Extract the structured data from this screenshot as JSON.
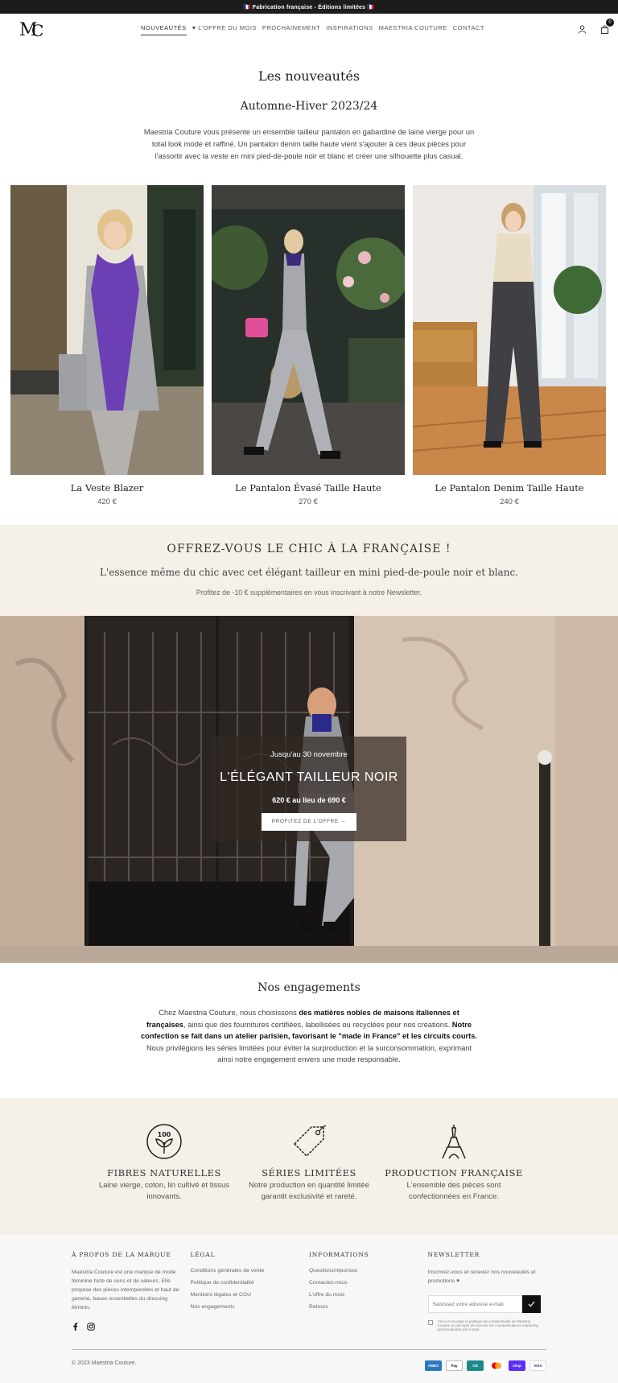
{
  "announcement": "🇫🇷 Fabrication française - Éditions limitées 🇫🇷",
  "brand": {
    "logo_text": "MC"
  },
  "nav": {
    "items": [
      {
        "label": "Nouveautés",
        "active": true
      },
      {
        "label": "♥ L'offre du mois",
        "active": false
      },
      {
        "label": "Prochainement",
        "active": false
      },
      {
        "label": "Inspirations",
        "active": false
      },
      {
        "label": "Maestria Couture",
        "active": false
      },
      {
        "label": "Contact",
        "active": false
      }
    ],
    "cart_count": "0"
  },
  "intro": {
    "title": "Les nouveautés",
    "season": "Automne-Hiver 2023/24",
    "text": "Maestria Couture vous présente un ensemble tailleur pantalon en gabardine de laine vierge pour un total look mode et raffiné. Un pantalon denim taille haute vient s'ajouter à ces deux pièces pour l'assortir avec la veste en mini pied-de-poule noir et blanc et créer une silhouette plus casual."
  },
  "products": [
    {
      "name": "La Veste Blazer",
      "price": "420 €"
    },
    {
      "name": "Le Pantalon Évasé Taille Haute",
      "price": "270 €"
    },
    {
      "name": "Le Pantalon Denim Taille Haute",
      "price": "240 €"
    }
  ],
  "offer": {
    "title": "OFFREZ-VOUS LE CHIC À LA FRANÇAISE !",
    "subtitle": "L'essence même du chic avec cet élégant tailleur en mini pied-de-poule noir et blanc.",
    "note": "Profitez de -10 € supplémentaires en vous inscrivant à notre Newsletter."
  },
  "hero": {
    "date": "Jusqu'au 30 novembre",
    "title": "L'ÉLÉGANT TAILLEUR NOIR",
    "price": "620 € au lieu de 690 €",
    "button": "PROFITEZ DE L'OFFRE →"
  },
  "engagements": {
    "title": "Nos engagements",
    "p1": "Chez Maestria Couture, nous choisissons ",
    "b1": "des matières nobles de maisons italiennes et françaises",
    "p2": ", ainsi que des fournitures certifiées, labellisées ou recyclées pour nos créations. ",
    "b2": "Notre confection se fait dans un atelier parisien, favorisant le \"made in France\" et les circuits courts.",
    "p3": " Nous privilégions les séries limitées pour éviter la surproduction et la surconsommation, exprimant ainsi notre engagement envers une mode responsable."
  },
  "features": [
    {
      "icon": "leaf-badge-icon",
      "badge": "100",
      "title": "FIBRES NATURELLES",
      "text": "Laine vierge, coton, lin cultivé et tissus innovants."
    },
    {
      "icon": "tag-icon",
      "title": "SÉRIES LIMITÉES",
      "text": "Notre production en quantité limitée garantit exclusivité et rareté."
    },
    {
      "icon": "eiffel-tower-icon",
      "title": "PRODUCTION FRANÇAISE",
      "text": "L'ensemble des pièces sont confectionnées en France."
    }
  ],
  "footer": {
    "about": {
      "heading": "À propos de la marque",
      "text": "Maestria Couture est une marque de mode féminine forte de sens et de valeurs. Elle propose des pièces intemporelles et haut de gamme, bases essentielles du dressing féminin."
    },
    "legal": {
      "heading": "Légal",
      "links": [
        "Conditions générales de vente",
        "Politique de confidentialité",
        "Mentions légales et CGU",
        "Nos engagements"
      ]
    },
    "info": {
      "heading": "Informations",
      "links": [
        "Questions/réponses",
        "Contactez-nous",
        "L'offre du mois",
        "Retours"
      ]
    },
    "newsletter": {
      "heading": "Newsletter",
      "text": "Inscrivez-vous et recevez nos nouveautés et promotions ♥",
      "placeholder": "Saisissez votre adresse e-mail",
      "consent": "J'ai lu et accepte la politique de confidentialité de Maestria Couture et j'accepte de recevoir les communications marketing personnalisées par e-mail."
    },
    "copyright": "© 2023 Maestria Couture.",
    "payments": [
      {
        "label": "AMEX",
        "color": "#2e77bc"
      },
      {
        "label": "Pay",
        "color": "#ffffff"
      },
      {
        "label": "CB",
        "color": "#1d8a8a"
      },
      {
        "label": "MC",
        "color": "#ffffff"
      },
      {
        "label": "shop",
        "color": "#5a31f4"
      },
      {
        "label": "VISA",
        "color": "#ffffff"
      }
    ]
  },
  "colors": {
    "accent_bg": "#f5f0e8",
    "dark": "#1c1c1c",
    "footer_bg": "#f7f7f7"
  }
}
